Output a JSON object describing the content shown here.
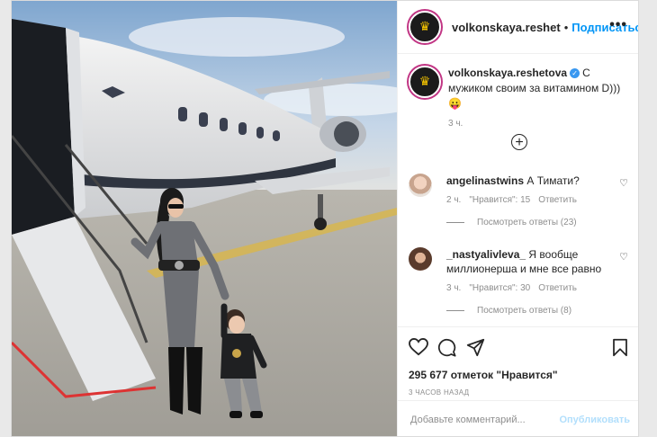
{
  "header": {
    "username": "volkonskaya.reshet",
    "separator": "•",
    "follow_label": "Подписаться",
    "more_glyph": "•••"
  },
  "caption": {
    "username": "volkonskaya.reshetova",
    "text": "С мужиком своим за витамином D))) 😛",
    "time": "3 ч."
  },
  "comments": [
    {
      "username": "angelinastwins",
      "text": "А Тимати?",
      "time": "2 ч.",
      "likes": "\"Нравится\": 15",
      "reply_label": "Ответить",
      "view_replies": "Посмотреть ответы (23)"
    },
    {
      "username": "_nastyalivleva_",
      "text": "Я вообще миллионерша и мне все равно",
      "time": "3 ч.",
      "likes": "\"Нравится\": 30",
      "reply_label": "Ответить",
      "view_replies": "Посмотреть ответы (8)"
    }
  ],
  "likes": "295 677 отметок \"Нравится\"",
  "time_ago": "3 ЧАСОВ НАЗАД",
  "add_comment": {
    "placeholder": "Добавьте комментарий...",
    "publish_label": "Опубликовать"
  },
  "colors": {
    "accent": "#0095f6",
    "publish_disabled": "#b2dffc",
    "text": "#262626",
    "muted": "#8e8e8e",
    "crown": "#f5c400"
  },
  "icons": {
    "crown": "♛",
    "plus": "+",
    "small_heart": "♡"
  }
}
